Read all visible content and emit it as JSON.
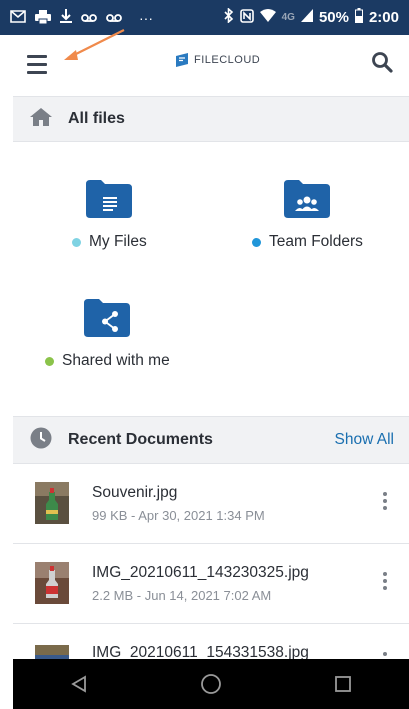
{
  "status_bar": {
    "battery": "50%",
    "time": "2:00",
    "network": "4G",
    "left_icons": [
      "gmail-icon",
      "print-icon",
      "download-icon",
      "voicemail-icon",
      "voicemail-icon",
      "more-icon"
    ],
    "right_icons": [
      "bluetooth-icon",
      "nfc-icon",
      "wifi-icon",
      "signal-icon",
      "battery-icon"
    ]
  },
  "app_bar": {
    "logo_text": "FILECLOUD",
    "menu_icon": "hamburger-menu-icon",
    "search_icon": "search-icon"
  },
  "all_files": {
    "title": "All files",
    "icon": "home-icon"
  },
  "tiles": [
    {
      "label": "My Files",
      "icon": "folder-doc-icon",
      "dot_color": "#7fd3e3"
    },
    {
      "label": "Team Folders",
      "icon": "folder-team-icon",
      "dot_color": "#2196d9"
    },
    {
      "label": "Shared with me",
      "icon": "folder-share-icon",
      "dot_color": "#8bc34a"
    }
  ],
  "recent": {
    "title": "Recent Documents",
    "show_all": "Show All",
    "icon": "clock-icon",
    "items": [
      {
        "name": "Souvenir.jpg",
        "meta": "99 KB - Apr 30, 2021 1:34 PM"
      },
      {
        "name": "IMG_20210611_143230325.jpg",
        "meta": "2.2 MB - Jun 14, 2021 7:02 AM"
      },
      {
        "name": "IMG_20210611_154331538.jpg",
        "meta": ""
      }
    ]
  },
  "nav_bar": {
    "back_icon": "back-triangle-icon",
    "home_icon": "home-circle-icon",
    "recents_icon": "recents-square-icon"
  },
  "colors": {
    "status_bar": "#1b3a63",
    "folder_blue": "#1f63a8",
    "accent_link": "#1a6fb0",
    "arrow": "#f08a4b"
  }
}
